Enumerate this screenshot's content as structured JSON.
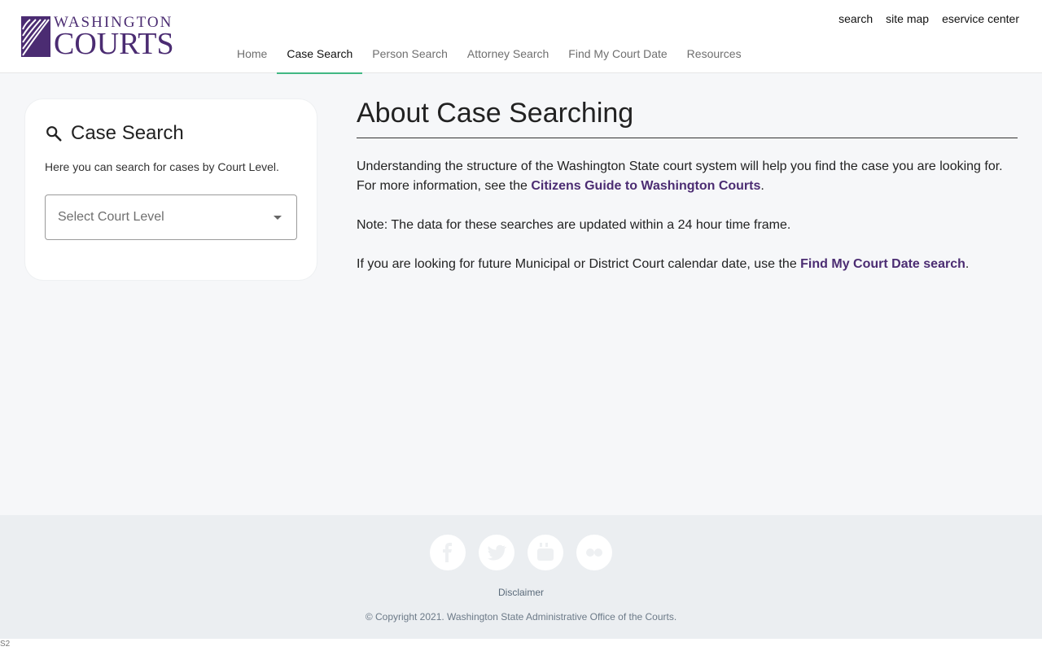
{
  "brand": {
    "logo_top": "WASHINGTON",
    "logo_bottom": "COURTS",
    "logo_icon": "courts-emblem-icon",
    "color": "#4b2c72"
  },
  "utility_links": [
    "search",
    "site map",
    "eservice center"
  ],
  "nav": {
    "items": [
      "Home",
      "Case Search",
      "Person Search",
      "Attorney Search",
      "Find My Court Date",
      "Resources"
    ],
    "active": "Case Search",
    "active_color": "#41b883"
  },
  "search_card": {
    "title": "Case Search",
    "icon": "search-icon",
    "description": "Here you can search for cases by Court Level.",
    "select_placeholder": "Select Court Level"
  },
  "main": {
    "heading": "About Case Searching",
    "p1_text": "Understanding the structure of the Washington State court system will help you find the case you are looking for. For more information, see the ",
    "p1_link": "Citizens Guide to Washington Courts",
    "p1_end": ".",
    "p2_text": "Note: The data for these searches are updated within a 24 hour time frame.",
    "p3_text": "If you are looking for future Municipal or District Court calendar date, use the ",
    "p3_link": "Find My Court Date search",
    "p3_end": "."
  },
  "footer": {
    "social_icons": [
      "facebook-icon",
      "twitter-icon",
      "youtube-icon",
      "flickr-icon"
    ],
    "disclaimer": "Disclaimer",
    "copyright": "© Copyright 2021. Washington State Administrative Office of the Courts."
  },
  "bottom_tag": "S2"
}
